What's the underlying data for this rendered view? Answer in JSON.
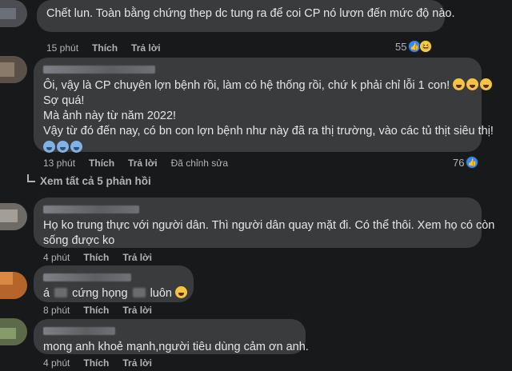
{
  "comments": [
    {
      "lines": [
        "Chết lun. Toàn bằng chứng thep dc tung ra để coi CP nó lươn đến mức độ nào."
      ],
      "time": "15 phút",
      "like_label": "Thích",
      "reply_label": "Trả lời",
      "reaction_count": "55"
    },
    {
      "lines": [
        "Ôi, vậy là CP chuyên lợn bệnh rồi, làm có hệ thống rồi, chứ k phải chỉ lỗi 1 con!",
        "Sợ quá!",
        "Mà ảnh này từ năm 2022!",
        "Vậy từ đó đến nay, có bn con lợn bệnh như này đã ra thị trường, vào các tủ thịt siêu thị!"
      ],
      "time": "13 phút",
      "like_label": "Thích",
      "reply_label": "Trả lời",
      "edited_label": "Đã chỉnh sửa",
      "reaction_count": "76"
    },
    {
      "lines": [
        "Họ ko trung thực với người dân. Thì người dân quay mặt đi. Có thể thôi. Xem họ có còn",
        "sống được ko"
      ],
      "time": "4 phút",
      "like_label": "Thích",
      "reply_label": "Trả lời"
    },
    {
      "text_a": "á",
      "text_b": "cứng họng",
      "text_c": "luôn",
      "time": "8 phút",
      "like_label": "Thích",
      "reply_label": "Trả lời"
    },
    {
      "lines": [
        "mong anh khoẻ mạnh,người tiêu dùng cảm ơn anh."
      ],
      "time": "4 phút",
      "like_label": "Thích",
      "reply_label": "Trả lời"
    }
  ],
  "view_more_label": "Xem tất cả 5 phản hồi",
  "icons": {
    "like": "like-icon",
    "haha": "haha-icon",
    "laugh_emoji": "grinning-squinting-face-emoji",
    "cold_emoji": "cold-face-emoji",
    "sweat_emoji": "grinning-sweat-emoji"
  },
  "colors": {
    "background": "#18191a",
    "bubble": "#3a3b3c",
    "text": "#e4e6eb",
    "meta": "#b0b3b8",
    "like_blue": "#2d88ff"
  }
}
